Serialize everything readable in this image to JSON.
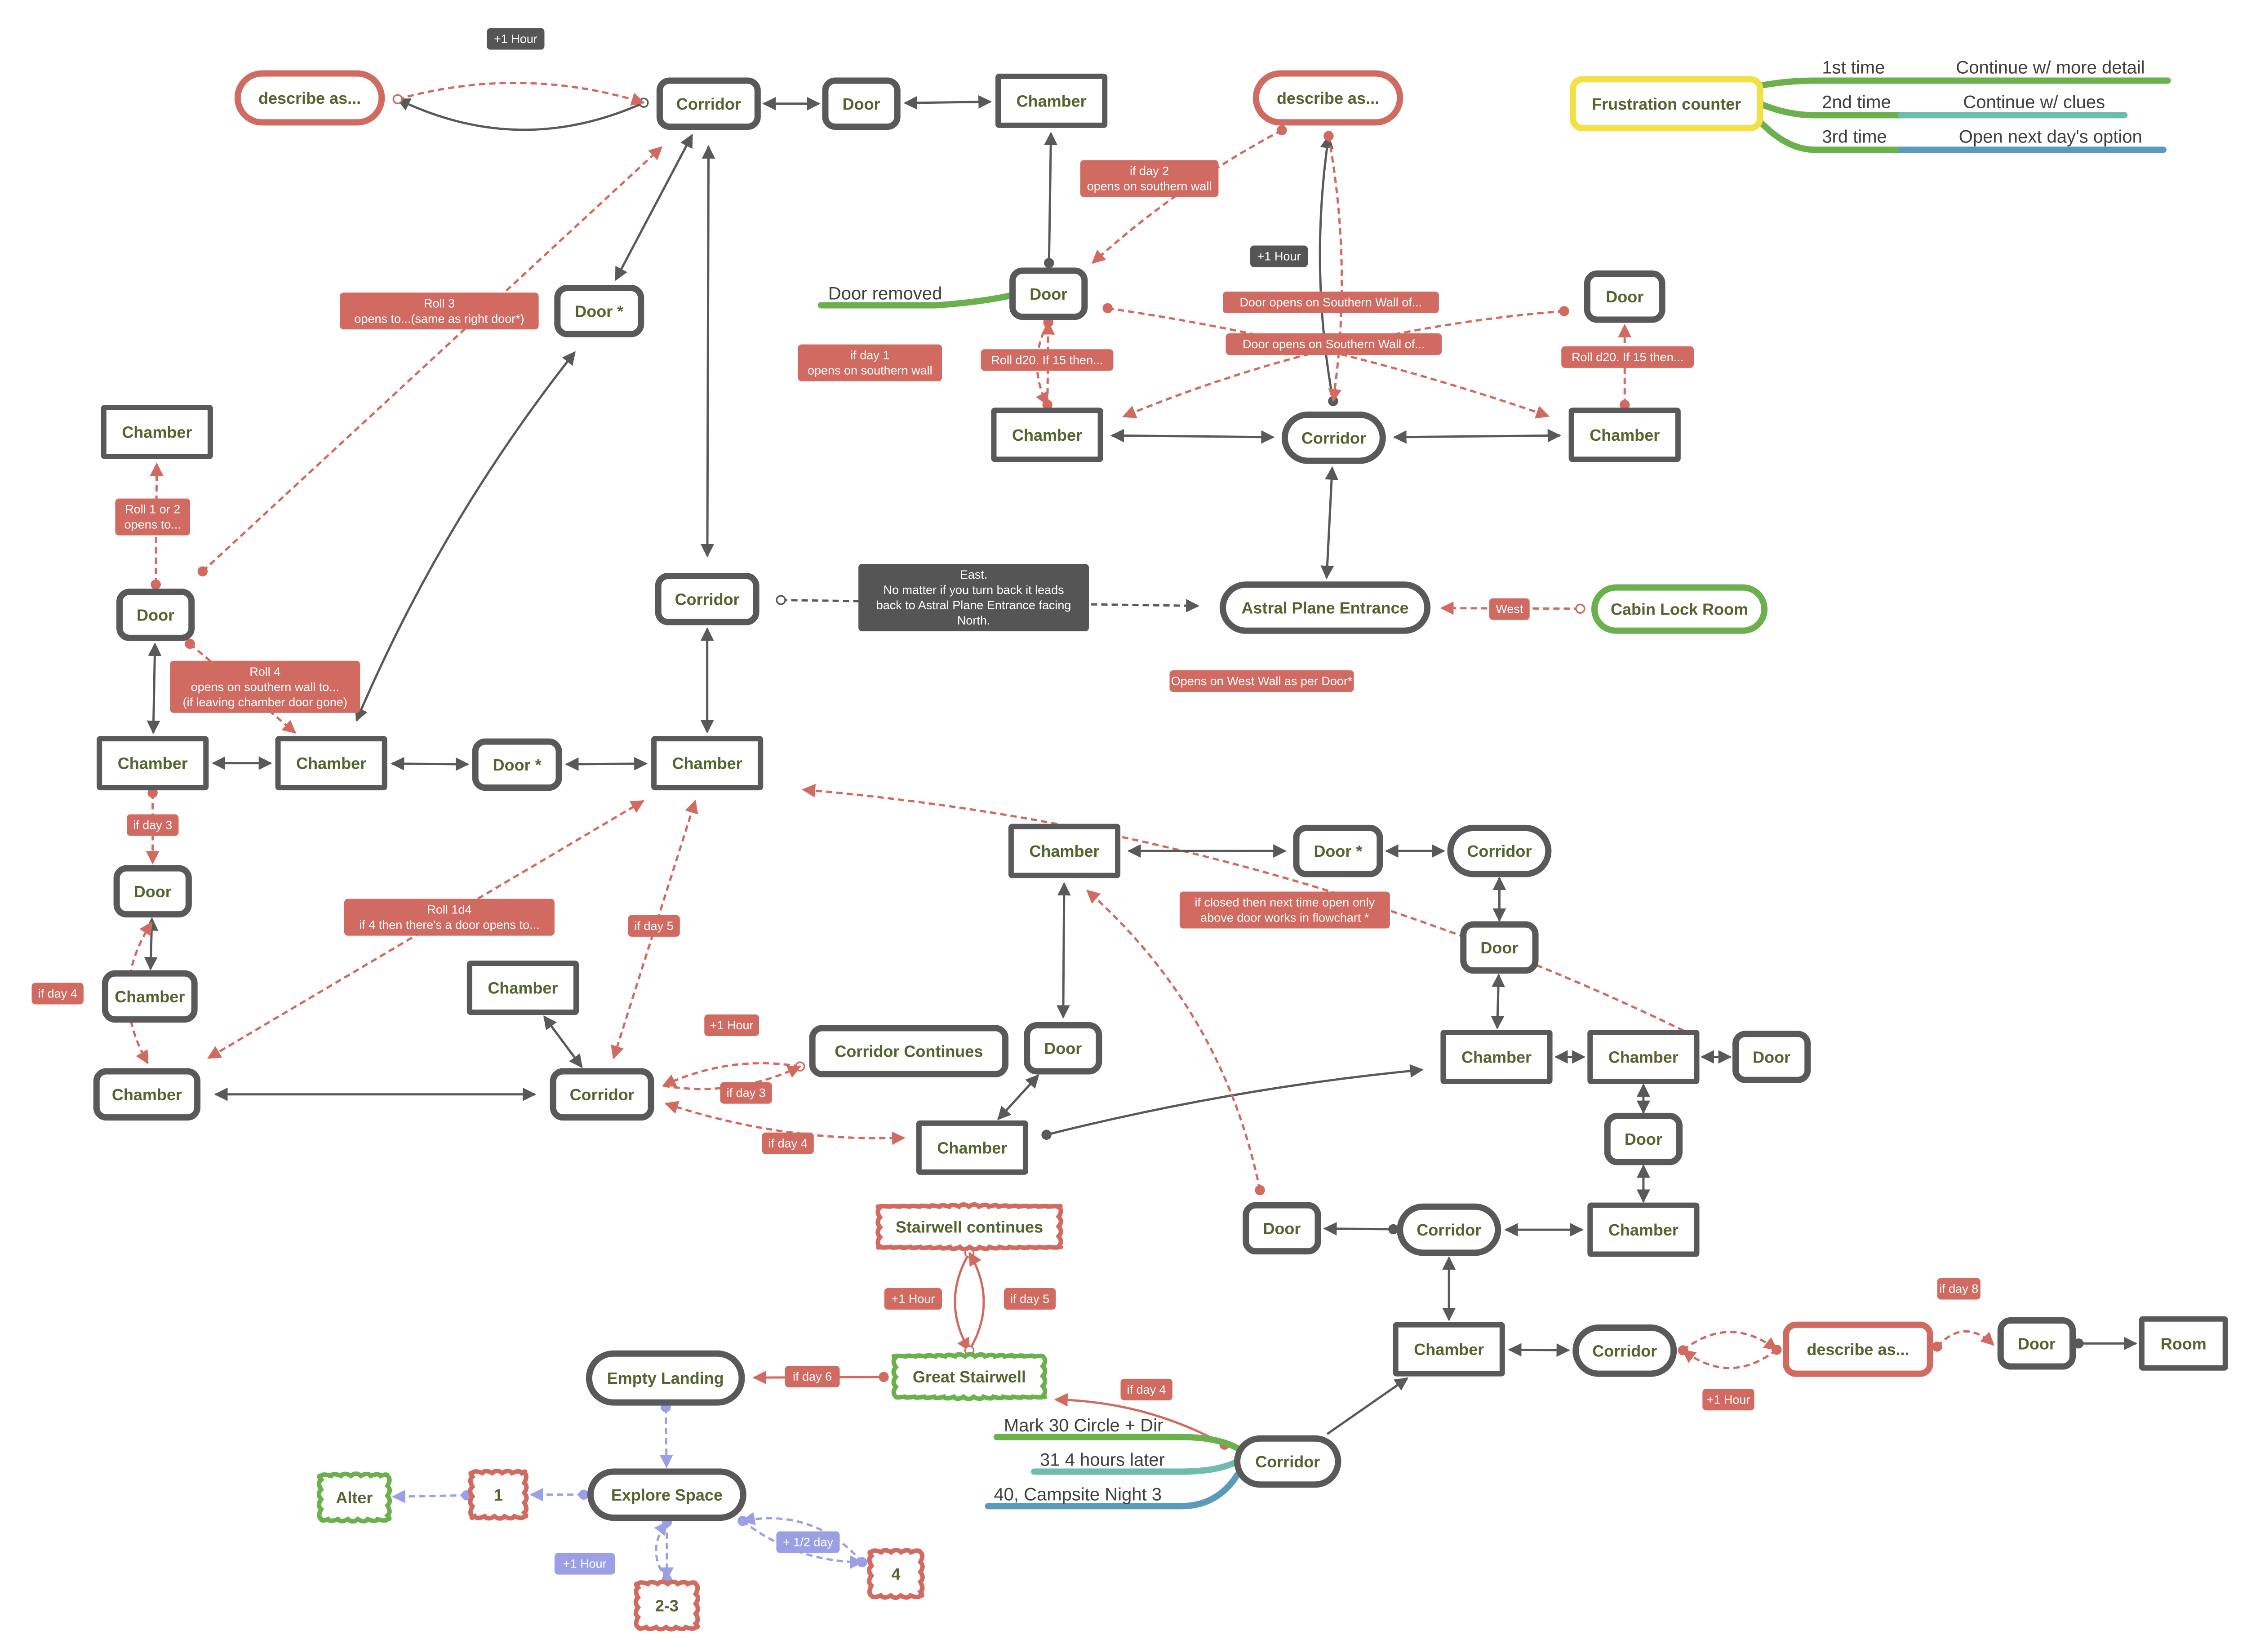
{
  "diagram": {
    "colors": {
      "node_stroke": "#595959",
      "node_text": "#55632f",
      "red": "#d16b61",
      "green": "#6ab04c",
      "yellow": "#f3e043",
      "teal": "#6dbcae",
      "blue": "#5a9bbb",
      "purple": "#9b9fe6",
      "dark_label": "#555555"
    },
    "nodes": {
      "describe_top_left": "describe as...",
      "corridor_top": "Corridor",
      "door_top": "Door",
      "chamber_top": "Chamber",
      "describe_top_mid": "describe as...",
      "frustration_counter": "Frustration counter",
      "door_star_top": "Door *",
      "door_mid": "Door",
      "door_right_top": "Door",
      "chamber_left_top": "Chamber",
      "chamber_mid_top": "Chamber",
      "corridor_mid_top": "Corridor",
      "chamber_right_top": "Chamber",
      "door_left": "Door",
      "corridor_center": "Corridor",
      "astral_plane_entrance": "Astral Plane Entrance",
      "cabin_lock_room": "Cabin Lock Room",
      "chamber_row_1": "Chamber",
      "chamber_row_2": "Chamber",
      "door_star_row": "Door *",
      "chamber_row_3": "Chamber",
      "chamber_c1": "Chamber",
      "door_star_c": "Door *",
      "corridor_c": "Corridor",
      "door_left_2": "Door",
      "door_c2": "Door",
      "chamber_left_round": "Chamber",
      "chamber_float": "Chamber",
      "corridor_continues": "Corridor Continues",
      "door_c3": "Door",
      "chamber_e1": "Chamber",
      "chamber_e2": "Chamber",
      "door_e": "Door",
      "chamber_bottom_left": "Chamber",
      "corridor_lower": "Corridor",
      "chamber_lower": "Chamber",
      "door_e2": "Door",
      "door_lower": "Door",
      "corridor_lower_right": "Corridor",
      "chamber_lower_right": "Chamber",
      "stairwell_continues": "Stairwell continues",
      "great_stairwell": "Great Stairwell",
      "empty_landing": "Empty Landing",
      "chamber_bottom": "Chamber",
      "corridor_bottom": "Corridor",
      "describe_bottom": "describe as...",
      "door_bottom": "Door",
      "room": "Room",
      "corridor_final": "Corridor",
      "explore_space": "Explore Space",
      "alter": "Alter",
      "one": "1",
      "two_three": "2-3",
      "four": "4"
    },
    "labels": {
      "plus1_top": "+1 Hour",
      "roll3": "Roll 3\nopens to...(same as right door*)",
      "if_day2": "if day 2\nopens on southern wall",
      "plus1_mid": "+1 Hour",
      "door_removed": "Door removed",
      "door_opens_1": "Door opens on Southern Wall of...",
      "door_opens_2": "Door opens on Southern Wall of...",
      "if_day1": "if day 1\nopens on southern wall",
      "roll_d20_a": "Roll d20. If 15 then...",
      "roll_d20_b": "Roll d20. If 15 then...",
      "roll12": "Roll 1 or 2\nopens to...",
      "east_note": "East.\nNo matter if you turn back it leads\nback to Astral Plane Entrance facing\nNorth.",
      "west": "West",
      "roll4": "Roll 4\nopens on southern wall to...\n(if leaving chamber door gone)",
      "opens_west": "Opens on West Wall as per Door*",
      "if_day3_a": "if day 3",
      "roll1d4": "Roll 1d4\nif 4 then there's a door opens to...",
      "if_day5_a": "if day 5",
      "if_closed": "if closed then next time open only\nabove door works in flowchart *",
      "if_day4_a": "if day 4",
      "plus1_cc": "+1 Hour",
      "if_day3_b": "if day 3",
      "if_day4_b": "if day 4",
      "plus1_stair": "+1 Hour",
      "if_day5_b": "if day 5",
      "if_day6": "if day 6",
      "if_day4_c": "if day 4",
      "if_day8": "if day 8",
      "plus1_bottom": "+1 Hour",
      "plus1_explore": "+1 Hour",
      "half_day": "+ 1/2 day"
    },
    "frustration_branches": [
      {
        "when": "1st time",
        "action": "Continue w/ more detail"
      },
      {
        "when": "2nd time",
        "action": "Continue w/ clues"
      },
      {
        "when": "3rd time",
        "action": "Open next day's option"
      }
    ],
    "corridor_branches": [
      "Mark 30 Circle + Dir",
      "31 4 hours later",
      "40, Campsite Night 3"
    ]
  }
}
